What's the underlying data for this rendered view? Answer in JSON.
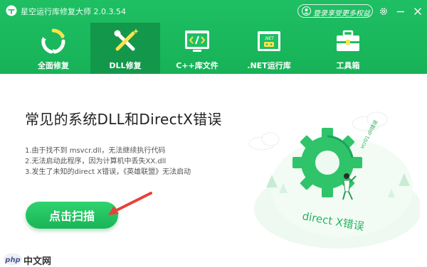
{
  "window": {
    "title": "星空运行库修复大师 2.0.3.54",
    "login_label": "登录享受更多权益"
  },
  "nav": {
    "tabs": [
      {
        "label": "全面修复",
        "icon": "recycle-icon",
        "active": false
      },
      {
        "label": "DLL修复",
        "icon": "wrench-screwdriver-icon",
        "active": true
      },
      {
        "label": "C++库文件",
        "icon": "code-window-icon",
        "active": false
      },
      {
        "label": ".NET运行库",
        "icon": "net-window-icon",
        "active": false
      },
      {
        "label": "工具箱",
        "icon": "toolbox-icon",
        "active": false
      }
    ]
  },
  "main": {
    "title": "常见的系统DLL和DirectX错误",
    "errors": [
      "1.由于找不到 msvcr.dll，无法继续执行代码",
      "2.无法启动此程序，因为计算机中丢失XX.dll",
      "3.发生了未知的direct X错误，《英雄联盟》无法启动"
    ],
    "scan_button": "点击扫描",
    "illustration": {
      "gear_text": "vcr01.dll错误",
      "ground_text": "direct X错误"
    }
  },
  "watermark": {
    "brand": "php",
    "text": "中文网"
  },
  "colors": {
    "header_green": "#1fbf63",
    "active_tab": "#13974a",
    "scan_button": "#22c363",
    "arrow_red": "#e8413a"
  }
}
